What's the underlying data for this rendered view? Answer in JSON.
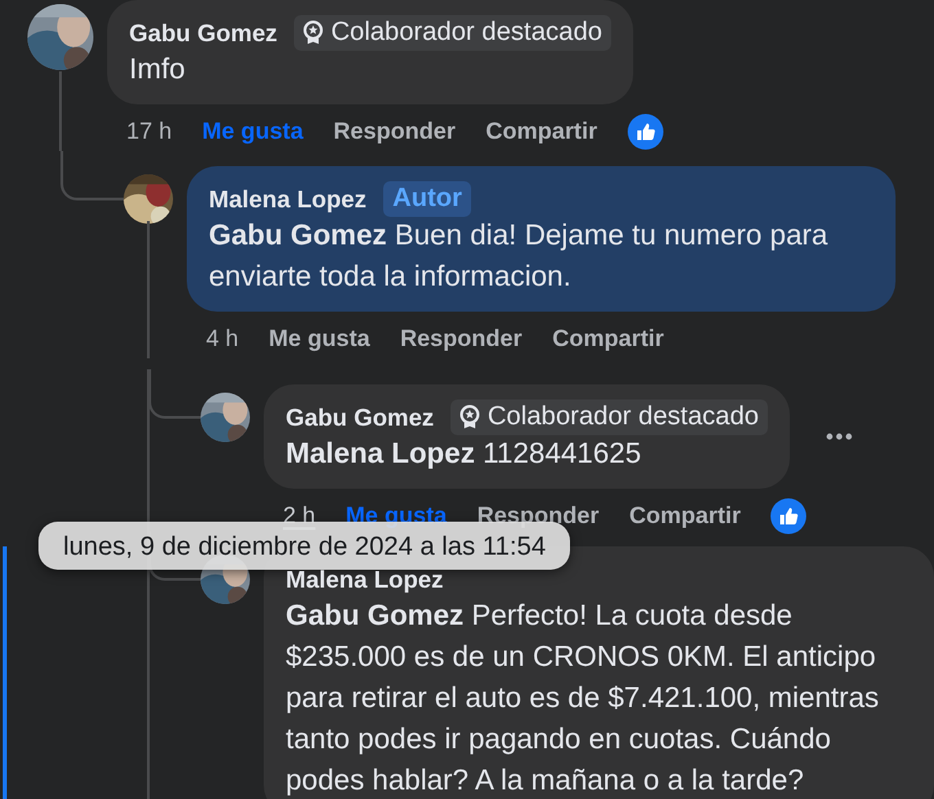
{
  "comments": [
    {
      "author": "Gabu Gomez",
      "badge": {
        "kind": "top-contributor",
        "label": "Colaborador destacado"
      },
      "text": "Imfo",
      "highlighted": false,
      "focused": false,
      "time": "17 h",
      "time_hovered": false,
      "liked": true,
      "actions": [
        "Me gusta",
        "Responder",
        "Compartir"
      ],
      "reaction": true,
      "more_menu": false,
      "children": [
        {
          "author": "Malena Lopez",
          "badge": {
            "kind": "author",
            "label": "Autor"
          },
          "text": "**Gabu Gomez** Buen dia! Dejame tu numero para enviarte toda la informacion.",
          "highlighted": true,
          "focused": false,
          "time": "4 h",
          "time_hovered": false,
          "liked": false,
          "actions": [
            "Me gusta",
            "Responder",
            "Compartir"
          ],
          "reaction": false,
          "more_menu": false,
          "children": [
            {
              "author": "Gabu Gomez",
              "badge": {
                "kind": "top-contributor",
                "label": "Colaborador destacado"
              },
              "text": "**Malena Lopez** 1128441625",
              "highlighted": false,
              "focused": false,
              "time": "2 h",
              "time_hovered": true,
              "liked": true,
              "actions": [
                "Me gusta",
                "Responder",
                "Compartir"
              ],
              "reaction": true,
              "more_menu": true
            },
            {
              "author": "Malena Lopez",
              "text": "**Gabu Gomez** Perfecto! La cuota desde $235.000 es de un CRONOS 0KM. El anticipo para retirar el auto es de $7.421.100, mientras tanto podes ir pagando en cuotas. Cuándo podes hablar? A la mañana o a la tarde?",
              "highlighted": false,
              "focused": true,
              "reaction": false,
              "more_menu": false
            }
          ]
        }
      ]
    }
  ],
  "tooltip": {
    "text": "lunes, 9 de diciembre de 2024 a las 11:54"
  }
}
